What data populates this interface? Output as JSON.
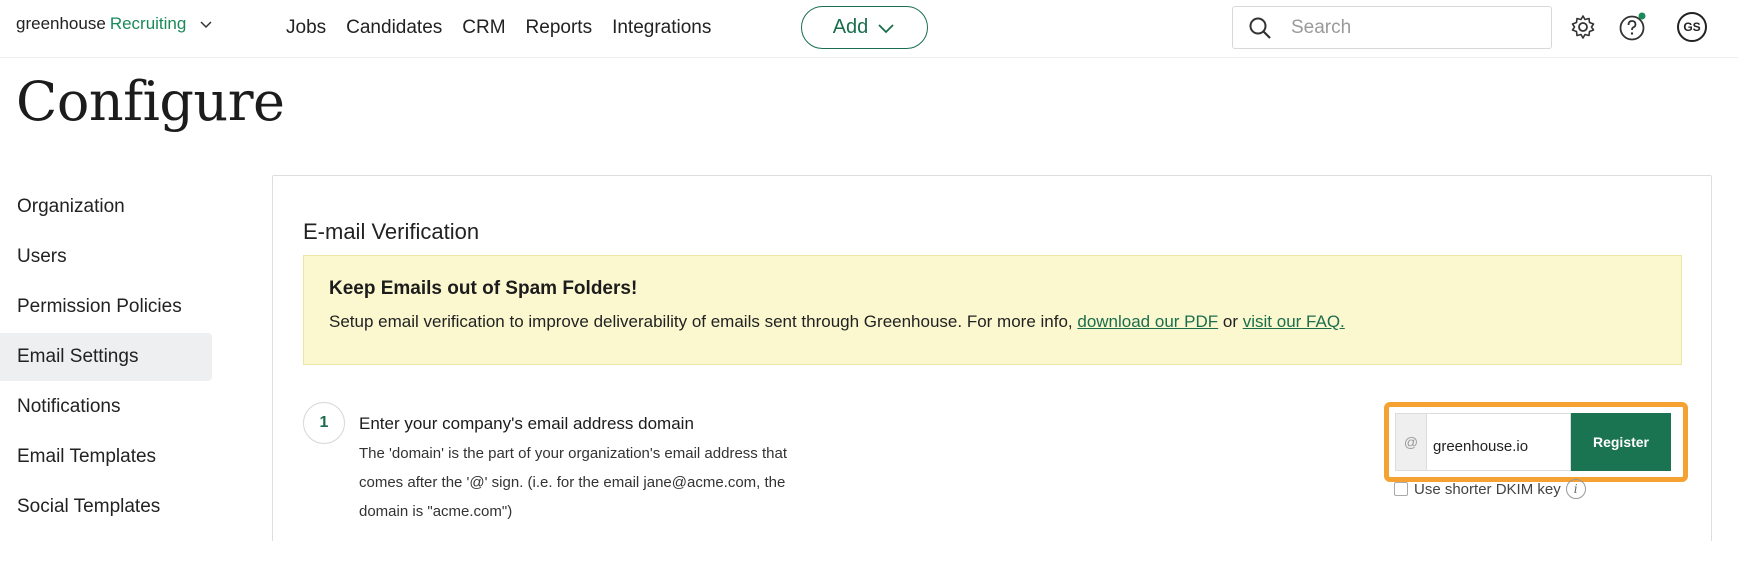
{
  "logo": {
    "brand": "greenhouse",
    "product": "Recruiting"
  },
  "nav": {
    "links": [
      "Jobs",
      "Candidates",
      "CRM",
      "Reports",
      "Integrations"
    ],
    "add_label": "Add",
    "search_placeholder": "Search",
    "avatar_initials": "GS",
    "notification_dot_color": "#1a8a5a"
  },
  "page": {
    "title": "Configure"
  },
  "sidebar": {
    "items": [
      {
        "label": "Organization",
        "active": false
      },
      {
        "label": "Users",
        "active": false
      },
      {
        "label": "Permission Policies",
        "active": false
      },
      {
        "label": "Email Settings",
        "active": true
      },
      {
        "label": "Notifications",
        "active": false
      },
      {
        "label": "Email Templates",
        "active": false
      },
      {
        "label": "Social Templates",
        "active": false
      }
    ]
  },
  "main": {
    "section_title": "E-mail Verification",
    "banner": {
      "heading": "Keep Emails out of Spam Folders!",
      "text_before": "Setup email verification to improve deliverability of emails sent through Greenhouse. For more info, ",
      "link_pdf": "download our PDF",
      "text_or": " or ",
      "link_faq": "visit our FAQ."
    },
    "step": {
      "number": "1",
      "title": "Enter your company's email address domain",
      "description_lines": [
        "The 'domain' is the part of your organization's email address that",
        "comes after the '@' sign. (i.e. for the email jane@acme.com, the",
        "domain is \"acme.com\")"
      ],
      "at_symbol": "@",
      "domain_value": "greenhouse.io",
      "register_label": "Register",
      "dkim_label": "Use shorter DKIM key",
      "info_symbol": "i"
    }
  },
  "colors": {
    "accent_green": "#1a6e4d",
    "banner_bg": "#fbf8cf",
    "highlight_orange": "#f5a233"
  }
}
